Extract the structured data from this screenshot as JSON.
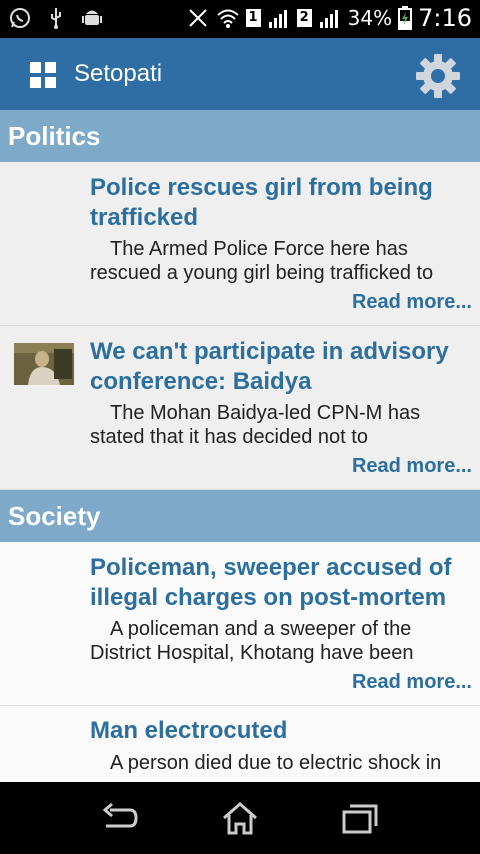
{
  "status_bar": {
    "battery_percent": "34%",
    "time": "7:16",
    "sim1": "1",
    "sim2": "2"
  },
  "app": {
    "title": "Setopati"
  },
  "sections": [
    {
      "name": "Politics",
      "articles": [
        {
          "title": "Police rescues girl from being trafficked",
          "summary": "The Armed Police Force here has rescued a young girl being trafficked to",
          "read_more": "Read more..."
        },
        {
          "title": "We can't participate in advisory conference: Baidya",
          "summary": "The Mohan Baidya-led CPN-M has stated that it has decided not to",
          "read_more": "Read more..."
        }
      ]
    },
    {
      "name": "Society",
      "articles": [
        {
          "title": "Policeman, sweeper accused of illegal charges on post-mortem",
          "summary": "A policeman and a sweeper of the District Hospital, Khotang have been",
          "read_more": "Read more..."
        },
        {
          "title": "Man electrocuted",
          "summary": "A person died due to electric shock in"
        }
      ]
    }
  ]
}
